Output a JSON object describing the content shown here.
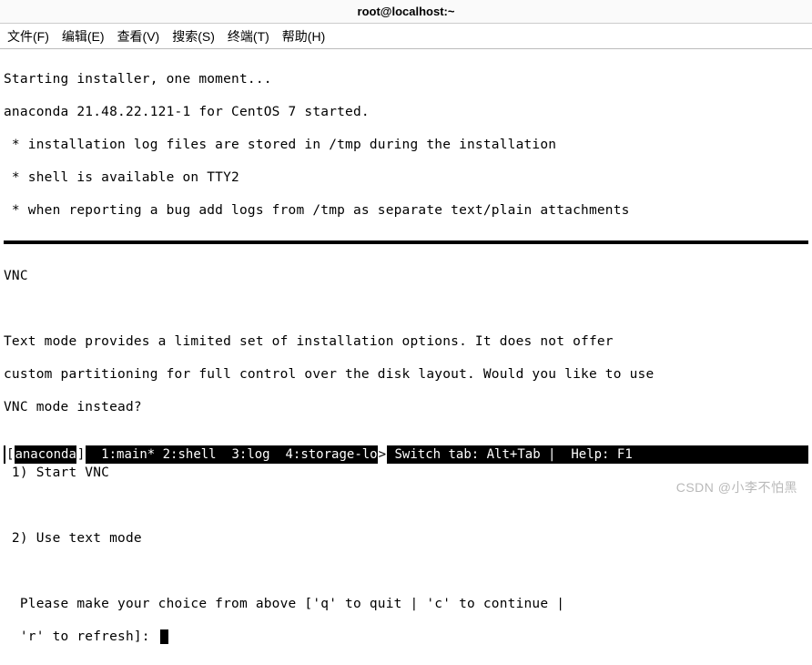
{
  "window": {
    "title": "root@localhost:~"
  },
  "menu": {
    "file": "文件(F)",
    "edit": "编辑(E)",
    "view": "查看(V)",
    "search": "搜索(S)",
    "terminal": "终端(T)",
    "help": "帮助(H)"
  },
  "term": {
    "l1": "Starting installer, one moment...",
    "l2": "anaconda 21.48.22.121-1 for CentOS 7 started.",
    "l3": " * installation log files are stored in /tmp during the installation",
    "l4": " * shell is available on TTY2",
    "l5": " * when reporting a bug add logs from /tmp as separate text/plain attachments",
    "section": "VNC",
    "p1": "Text mode provides a limited set of installation options. It does not offer",
    "p2": "custom partitioning for full control over the disk layout. Would you like to use",
    "p3": "VNC mode instead?",
    "opt1": " 1) Start VNC",
    "opt2": " 2) Use text mode",
    "prompt1": "  Please make your choice from above ['q' to quit | 'c' to continue |",
    "prompt2": "  'r' to refresh]: "
  },
  "status": {
    "left_bracket": "[",
    "app": "anaconda",
    "right_bracket": "]",
    "tabs": "  1:main* 2:shell  3:log  4:storage-lo",
    "arrow": ">",
    "hint": " Switch tab: Alt+Tab |  Help: F1 "
  },
  "watermark": "CSDN @小李不怕黑"
}
